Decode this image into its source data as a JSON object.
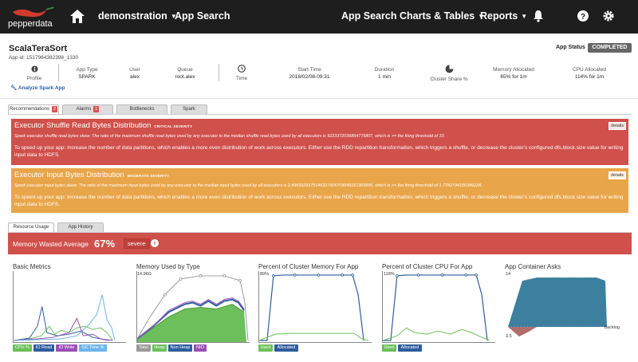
{
  "nav": {
    "logo_text": "pepperdata",
    "cluster": "demonstration",
    "section": "App Search",
    "links": [
      "App Search",
      "Charts & Tables",
      "Reports"
    ]
  },
  "app": {
    "title": "ScalaTeraSort",
    "app_id": "App id: 1517964382398_1330",
    "status_label": "App Status",
    "status_value": "COMPLETED",
    "analyze_label": "Analyze Spark App"
  },
  "stats": {
    "profile": "Profile",
    "app_type_label": "App Type",
    "app_type": "SPARK",
    "user_label": "User",
    "user": "alex",
    "queue_label": "Queue",
    "queue": "root.alex",
    "time": "Time",
    "start_label": "Start Time",
    "start": "2018/02/08-09:31",
    "duration_label": "Duration",
    "duration": "1 min",
    "cluster_share": "Cluster Share %",
    "mem_label": "Memory Allocated",
    "mem": "65% for 1m",
    "cpu_label": "CPU Allocated",
    "cpu": "114% for 1m"
  },
  "tabs1": [
    {
      "label": "Recommendations",
      "badge": "2"
    },
    {
      "label": "Alarms",
      "badge": "1"
    },
    {
      "label": "Bottlenecks",
      "badge": ""
    },
    {
      "label": "Spark",
      "badge": ""
    }
  ],
  "recs": [
    {
      "title": "Executor Shuffle Read Bytes Distribution",
      "severity": "CRITICAL SEVERITY",
      "detail": "Spark executor shuffle read bytes skew: The ratio of the maximum shuffle read bytes used by any executor to the median shuffle read bytes used by all executors is 9223372036854775807, which is >= the firing threshold of 10.",
      "advice": "To speed up your app: Increase the number of data partitions, which enables a more even distribution of work across executors. Either use the RDD repartition transformation, which triggers a shuffle, or decrease the cluster's configured dfs.block.size value for writing input data to HDFS.",
      "details_label": "details"
    },
    {
      "title": "Executor Input Bytes Distribution",
      "severity": "MODERATE SEVERITY",
      "detail": "Spark executor input bytes skew: The ratio of the maximum input bytes used by any executor to the median input bytes used by all executors is 2.4965929379146327505709049161369995, which is >= the firing threshold of 1.7782794100389228.",
      "advice": "To speed up your app: Increase the number of data partitions, which enables a more even distribution of work across executors. Either use the RDD repartition transformation, which triggers a shuffle, or decrease the cluster's configured dfs.block.size value for writing input data to HDFS.",
      "details_label": "details"
    }
  ],
  "tabs2": [
    "Resource Usage",
    "App History"
  ],
  "memory_wasted": {
    "label": "Memory Wasted Average",
    "value": "67%",
    "severity": "severe"
  },
  "charts": [
    {
      "title": "Basic Metrics",
      "ytop": "",
      "ybot": "",
      "legend": [
        "CPU %",
        "IO Read",
        "IO Write",
        "GC Time %"
      ]
    },
    {
      "title": "Memory Used by Type",
      "ytop": "14.96G",
      "ybot": "",
      "legend": [
        "Total",
        "Heap",
        "Non Heap",
        "NIO"
      ]
    },
    {
      "title": "Percent of Cluster Memory For App",
      "ytop": "89%",
      "ybot": "",
      "legend": [
        "Used",
        "Allocated"
      ]
    },
    {
      "title": "Percent of Cluster CPU For App",
      "ytop": "118%",
      "ybot": "",
      "legend": [
        "Used",
        "Allocated"
      ]
    },
    {
      "title": "App Container Asks",
      "ytop": "14",
      "ybot": "3.5",
      "legend": [
        "backlog"
      ]
    }
  ],
  "colors": {
    "nav_bg": "#1e1e1e",
    "critical": "#d0504b",
    "moderate": "#e9a54a",
    "green": "#6cbf5a",
    "blue": "#2f5d9e",
    "purple": "#9b4fb8",
    "teal": "#3d7f9e",
    "lightblue": "#6db5e8",
    "gray": "#999999"
  }
}
